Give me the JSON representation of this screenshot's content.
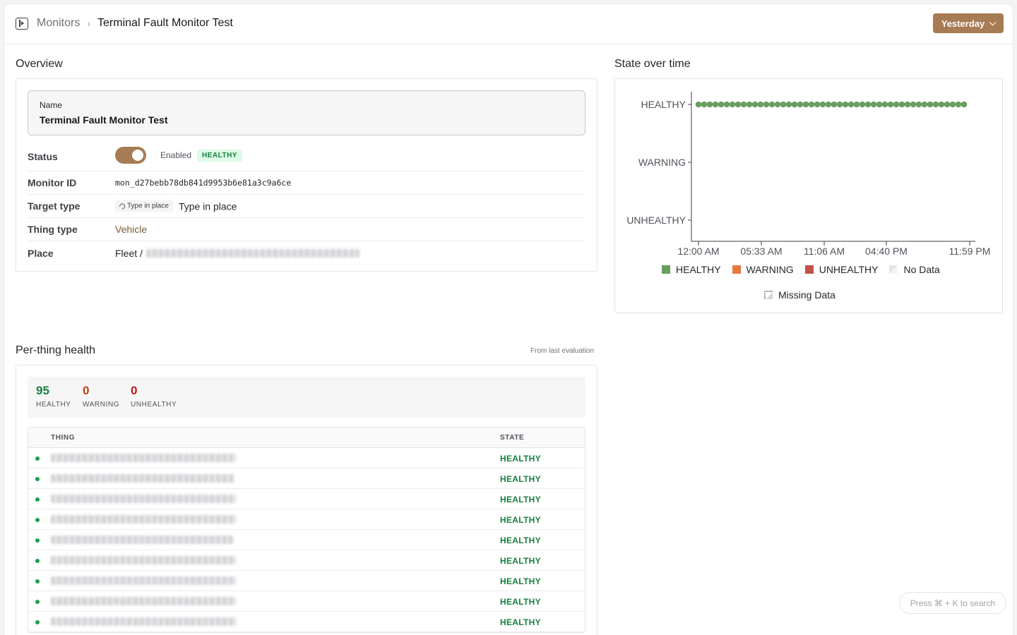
{
  "header": {
    "breadcrumb_parent": "Monitors",
    "breadcrumb_separator": "›",
    "breadcrumb_current": "Terminal Fault Monitor Test",
    "date_range": "Yesterday"
  },
  "overview": {
    "title": "Overview",
    "name_label": "Name",
    "name_value": "Terminal Fault Monitor Test",
    "status_label": "Status",
    "status_enabled": true,
    "status_enabled_text": "Enabled",
    "status_badge": "HEALTHY",
    "monitor_id_label": "Monitor ID",
    "monitor_id_value": "mon_d27bebb78db841d9953b6e81a3c9a6ce",
    "target_type_label": "Target type",
    "target_type_chip": "Type in place",
    "target_type_value": "Type in place",
    "thing_type_label": "Thing type",
    "thing_type_value": "Vehicle",
    "place_label": "Place",
    "place_value": "Fleet /"
  },
  "state_over_time": {
    "title": "State over time",
    "legend": [
      "HEALTHY",
      "WARNING",
      "UNHEALTHY",
      "No Data"
    ],
    "legend_missing": "Missing Data"
  },
  "chart_data": {
    "type": "scatter",
    "y_categories": [
      "HEALTHY",
      "WARNING",
      "UNHEALTHY"
    ],
    "x_tick_labels": [
      "12:00 AM",
      "05:33 AM",
      "11:06 AM",
      "04:40 PM",
      "11:59 PM"
    ],
    "series": [
      {
        "name": "HEALTHY",
        "color": "#6a9e5f",
        "point_count": 48,
        "state": "HEALTHY"
      }
    ],
    "legend_colors": {
      "HEALTHY": "#6a9e5f",
      "WARNING": "#e8793d",
      "UNHEALTHY": "#c0524a"
    },
    "legend_placement": "bottom"
  },
  "per_thing": {
    "title": "Per-thing health",
    "subtitle": "From last evaluation",
    "healthy_count": "95",
    "healthy_label": "HEALTHY",
    "warning_count": "0",
    "warning_label": "WARNING",
    "unhealthy_count": "0",
    "unhealthy_label": "UNHEALTHY",
    "col_thing": "THING",
    "col_state": "STATE",
    "rows": [
      {
        "state": "HEALTHY"
      },
      {
        "state": "HEALTHY"
      },
      {
        "state": "HEALTHY"
      },
      {
        "state": "HEALTHY"
      },
      {
        "state": "HEALTHY"
      },
      {
        "state": "HEALTHY"
      },
      {
        "state": "HEALTHY"
      },
      {
        "state": "HEALTHY"
      },
      {
        "state": "HEALTHY"
      }
    ]
  },
  "search_hint": "Press ⌘ + K to search",
  "colors": {
    "accent": "#a77b53",
    "healthy_green": "#15803d"
  }
}
